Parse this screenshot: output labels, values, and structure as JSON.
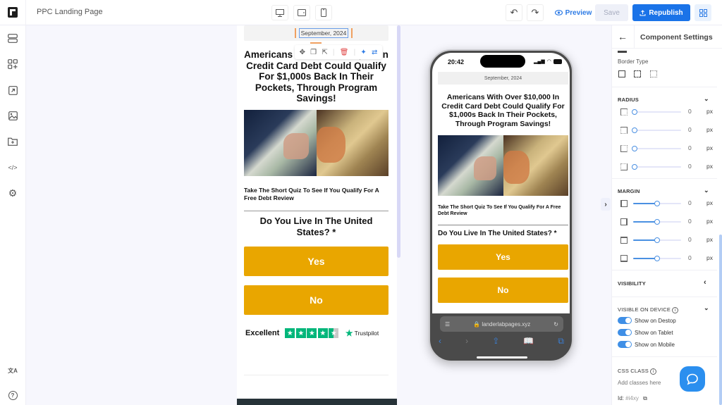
{
  "app": {
    "title": "PPC Landing Page",
    "accent_color": "#1a73e8"
  },
  "toolbar": {
    "devices": [
      {
        "name": "desktop",
        "icon": "desktop-icon"
      },
      {
        "name": "tablet",
        "icon": "tablet-icon"
      },
      {
        "name": "mobile",
        "icon": "mobile-icon"
      }
    ],
    "undo_icon": "↶",
    "redo_icon": "↷",
    "preview_label": "Preview",
    "save_label": "Save",
    "republish_label": "Republish"
  },
  "sidebar": {
    "items": [
      {
        "name": "sections",
        "icon": "sections-icon"
      },
      {
        "name": "add-components",
        "icon": "add-components-icon"
      },
      {
        "name": "popups",
        "icon": "external-link-icon"
      },
      {
        "name": "media",
        "icon": "image-icon"
      },
      {
        "name": "files",
        "icon": "folder-icon"
      },
      {
        "name": "code",
        "icon": "code-icon",
        "glyph": "</>"
      },
      {
        "name": "settings",
        "icon": "gear-icon",
        "glyph": "⚙"
      },
      {
        "name": "translate",
        "icon": "translate-icon",
        "glyph": "文A"
      },
      {
        "name": "help",
        "icon": "help-icon",
        "glyph": "?"
      }
    ]
  },
  "canvas": {
    "date": "September, 2024",
    "headline": "Americans With Over $10,000 In Credit Card Debt Could Qualify For $1,000s Back In Their Pockets, Through Program Savings!",
    "subheadline": "Take The Short Quiz To See If You Qualify For A Free Debt Review",
    "question": "Do You Live In The United States? *",
    "yes_label": "Yes",
    "no_label": "No",
    "cta_color": "#e9a600",
    "rating_label": "Excellent",
    "rating_stars": 4.5,
    "rating_brand": "Trustpilot",
    "float_toolbar": [
      "move-icon",
      "copy-icon",
      "select-parent-icon",
      "delete-icon",
      "ai-magic-icon",
      "swap-icon"
    ]
  },
  "phone": {
    "time": "20:42",
    "battery": "41",
    "date": "September, 2024",
    "headline": "Americans With Over $10,000 In Credit Card Debt Could Qualify For $1,000s Back In Their Pockets, Through Program Savings!",
    "subheadline": "Take The Short Quiz To See If You Qualify For A Free Debt Review",
    "question": "Do You Live In The United States? *",
    "yes_label": "Yes",
    "no_label": "No",
    "url": "landerlabpages.xyz"
  },
  "panel": {
    "title": "Component Settings",
    "border_type_label": "Border Type",
    "radius": {
      "label": "RADIUS",
      "rows": [
        {
          "corner": "top-left",
          "value": "0",
          "unit": "px"
        },
        {
          "corner": "top-right",
          "value": "0",
          "unit": "px"
        },
        {
          "corner": "bottom-left",
          "value": "0",
          "unit": "px"
        },
        {
          "corner": "bottom-right",
          "value": "0",
          "unit": "px"
        }
      ]
    },
    "margin": {
      "label": "MARGIN",
      "rows": [
        {
          "side": "left",
          "value": "0",
          "unit": "px",
          "slider_fraction": 0.5
        },
        {
          "side": "right",
          "value": "0",
          "unit": "px",
          "slider_fraction": 0.5
        },
        {
          "side": "top",
          "value": "0",
          "unit": "px",
          "slider_fraction": 0.5
        },
        {
          "side": "bottom",
          "value": "0",
          "unit": "px",
          "slider_fraction": 0.5
        }
      ]
    },
    "visibility_label": "VISIBILITY",
    "visible_on_device": {
      "label": "VISIBLE ON DEVICE",
      "toggles": [
        {
          "label": "Show on Destop",
          "on": true
        },
        {
          "label": "Show on Tablet",
          "on": true
        },
        {
          "label": "Show on Mobile",
          "on": true
        }
      ]
    },
    "css_class": {
      "label": "CSS CLASS",
      "placeholder": "Add classes here",
      "id_label": "Id:",
      "id_value": "#i4xy"
    }
  }
}
